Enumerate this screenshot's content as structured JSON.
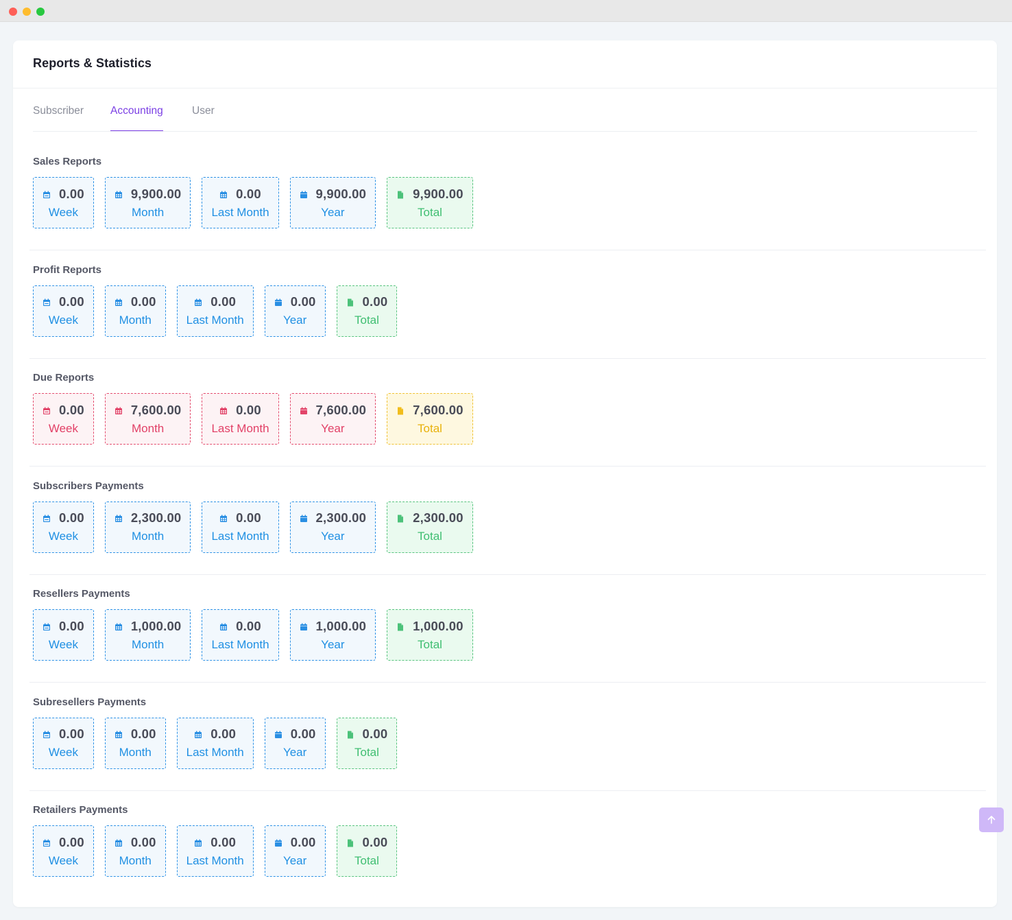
{
  "header": {
    "title": "Reports & Statistics"
  },
  "tabs": [
    {
      "label": "Subscriber",
      "active": false
    },
    {
      "label": "Accounting",
      "active": true
    },
    {
      "label": "User",
      "active": false
    }
  ],
  "colors": {
    "accent": "#7b3fe4",
    "blue": "#2090e3",
    "green": "#3fbe71",
    "red": "#e24167",
    "yellow": "#e8b20c"
  },
  "sections": [
    {
      "title": "Sales Reports",
      "items": [
        {
          "value": "0.00",
          "label": "Week",
          "color": "blue",
          "icon": "calendar-minus-icon"
        },
        {
          "value": "9,900.00",
          "label": "Month",
          "color": "blue",
          "icon": "calendar-grid-icon"
        },
        {
          "value": "0.00",
          "label": "Last Month",
          "color": "blue",
          "icon": "calendar-grid-icon"
        },
        {
          "value": "9,900.00",
          "label": "Year",
          "color": "blue",
          "icon": "calendar-icon"
        },
        {
          "value": "9,900.00",
          "label": "Total",
          "color": "green",
          "icon": "file-icon"
        }
      ]
    },
    {
      "title": "Profit Reports",
      "items": [
        {
          "value": "0.00",
          "label": "Week",
          "color": "blue",
          "icon": "calendar-minus-icon"
        },
        {
          "value": "0.00",
          "label": "Month",
          "color": "blue",
          "icon": "calendar-grid-icon"
        },
        {
          "value": "0.00",
          "label": "Last Month",
          "color": "blue",
          "icon": "calendar-grid-icon"
        },
        {
          "value": "0.00",
          "label": "Year",
          "color": "blue",
          "icon": "calendar-icon"
        },
        {
          "value": "0.00",
          "label": "Total",
          "color": "green",
          "icon": "file-icon"
        }
      ]
    },
    {
      "title": "Due Reports",
      "items": [
        {
          "value": "0.00",
          "label": "Week",
          "color": "red",
          "icon": "calendar-minus-icon"
        },
        {
          "value": "7,600.00",
          "label": "Month",
          "color": "red",
          "icon": "calendar-grid-icon"
        },
        {
          "value": "0.00",
          "label": "Last Month",
          "color": "red",
          "icon": "calendar-grid-icon"
        },
        {
          "value": "7,600.00",
          "label": "Year",
          "color": "red",
          "icon": "calendar-icon"
        },
        {
          "value": "7,600.00",
          "label": "Total",
          "color": "yellow",
          "icon": "file-icon"
        }
      ]
    },
    {
      "title": "Subscribers Payments",
      "items": [
        {
          "value": "0.00",
          "label": "Week",
          "color": "blue",
          "icon": "calendar-minus-icon"
        },
        {
          "value": "2,300.00",
          "label": "Month",
          "color": "blue",
          "icon": "calendar-grid-icon"
        },
        {
          "value": "0.00",
          "label": "Last Month",
          "color": "blue",
          "icon": "calendar-grid-icon"
        },
        {
          "value": "2,300.00",
          "label": "Year",
          "color": "blue",
          "icon": "calendar-icon"
        },
        {
          "value": "2,300.00",
          "label": "Total",
          "color": "green",
          "icon": "file-icon"
        }
      ]
    },
    {
      "title": "Resellers Payments",
      "items": [
        {
          "value": "0.00",
          "label": "Week",
          "color": "blue",
          "icon": "calendar-minus-icon"
        },
        {
          "value": "1,000.00",
          "label": "Month",
          "color": "blue",
          "icon": "calendar-grid-icon"
        },
        {
          "value": "0.00",
          "label": "Last Month",
          "color": "blue",
          "icon": "calendar-grid-icon"
        },
        {
          "value": "1,000.00",
          "label": "Year",
          "color": "blue",
          "icon": "calendar-icon"
        },
        {
          "value": "1,000.00",
          "label": "Total",
          "color": "green",
          "icon": "file-icon"
        }
      ]
    },
    {
      "title": "Subresellers Payments",
      "items": [
        {
          "value": "0.00",
          "label": "Week",
          "color": "blue",
          "icon": "calendar-minus-icon"
        },
        {
          "value": "0.00",
          "label": "Month",
          "color": "blue",
          "icon": "calendar-grid-icon"
        },
        {
          "value": "0.00",
          "label": "Last Month",
          "color": "blue",
          "icon": "calendar-grid-icon"
        },
        {
          "value": "0.00",
          "label": "Year",
          "color": "blue",
          "icon": "calendar-icon"
        },
        {
          "value": "0.00",
          "label": "Total",
          "color": "green",
          "icon": "file-icon"
        }
      ]
    },
    {
      "title": "Retailers Payments",
      "items": [
        {
          "value": "0.00",
          "label": "Week",
          "color": "blue",
          "icon": "calendar-minus-icon"
        },
        {
          "value": "0.00",
          "label": "Month",
          "color": "blue",
          "icon": "calendar-grid-icon"
        },
        {
          "value": "0.00",
          "label": "Last Month",
          "color": "blue",
          "icon": "calendar-grid-icon"
        },
        {
          "value": "0.00",
          "label": "Year",
          "color": "blue",
          "icon": "calendar-icon"
        },
        {
          "value": "0.00",
          "label": "Total",
          "color": "green",
          "icon": "file-icon"
        }
      ]
    }
  ],
  "scroll_top_icon": "arrow-up-icon"
}
